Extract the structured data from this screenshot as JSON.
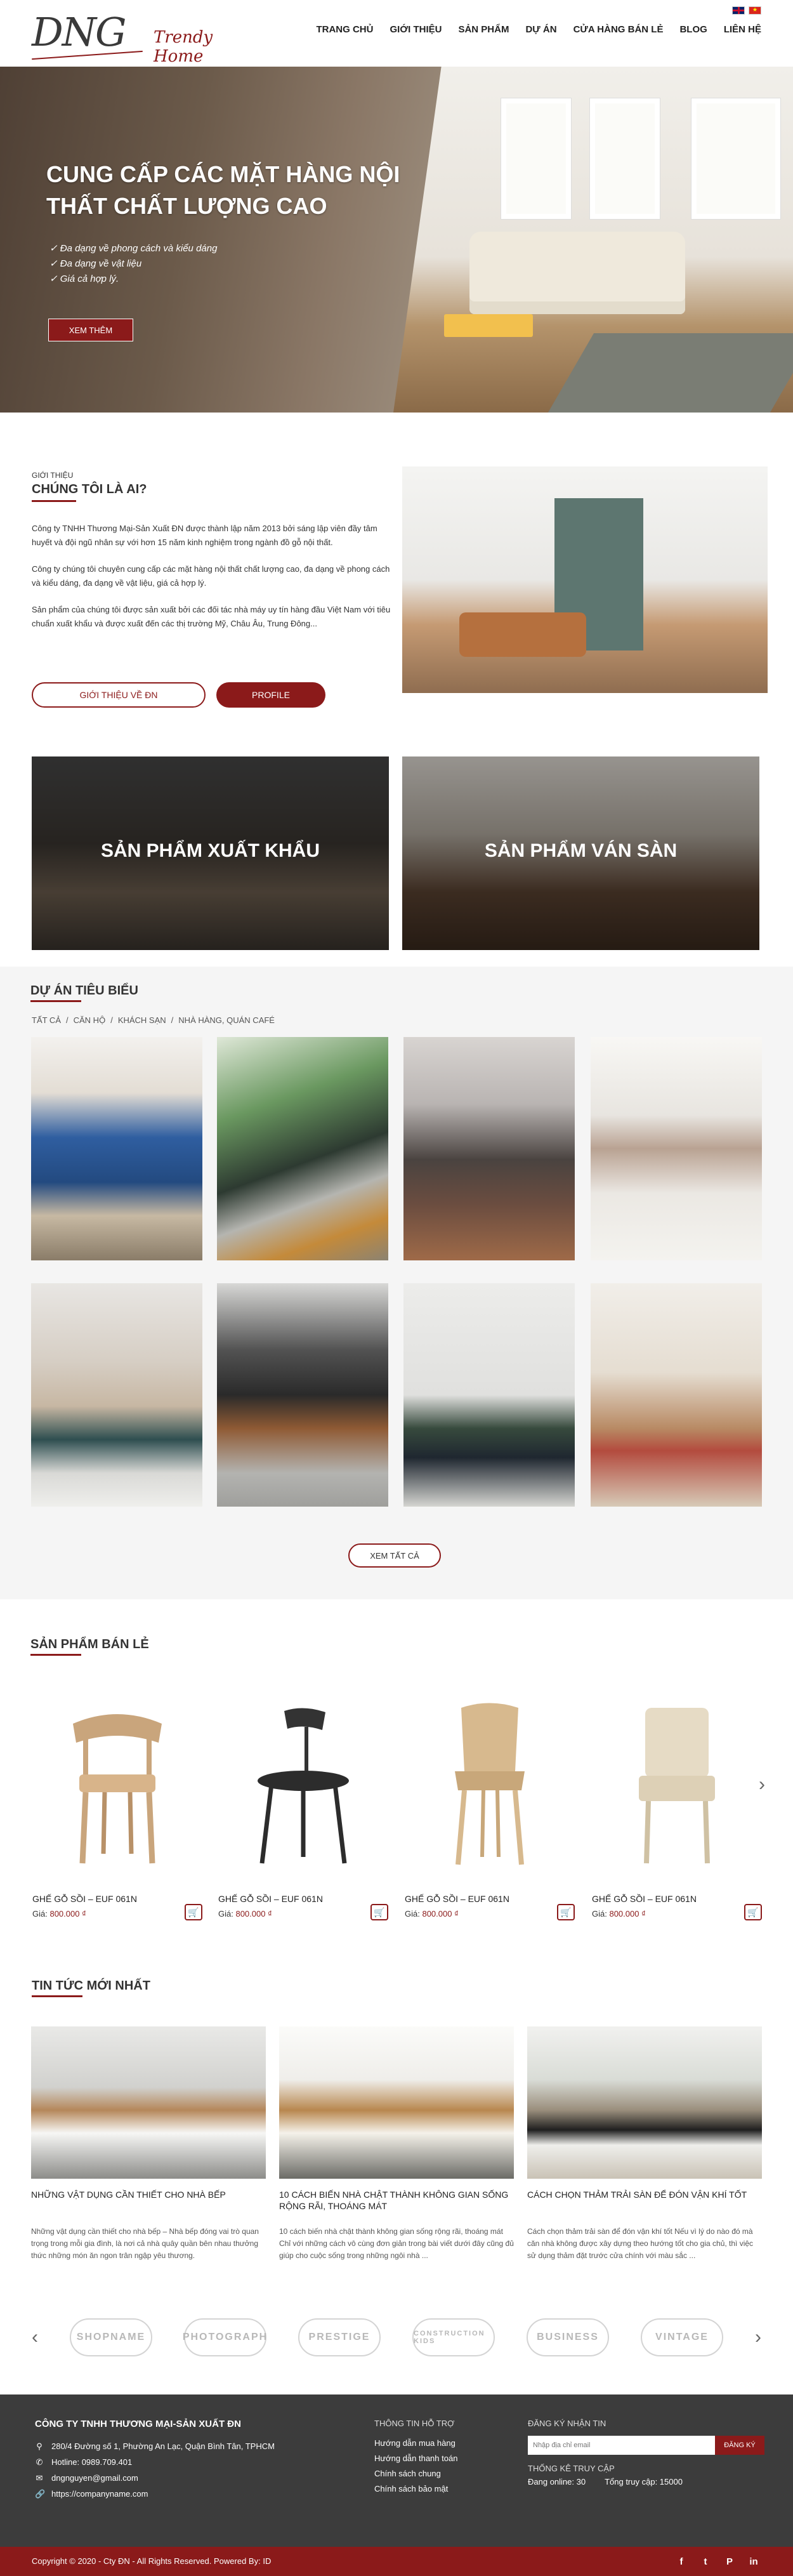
{
  "brand": {
    "logo_text": "DNG",
    "tagline": "Trendy Home"
  },
  "nav": [
    "TRANG CHỦ",
    "GIỚI THIỆU",
    "SẢN PHẨM",
    "DỰ ÁN",
    "CỬA HÀNG BÁN LẺ",
    "BLOG",
    "LIÊN HỆ"
  ],
  "hero": {
    "title": "CUNG CẤP CÁC MẶT HÀNG NỘI THẤT CHẤT LƯỢNG CAO",
    "features": [
      "Đa dạng về phong cách và kiểu dáng",
      "Đa dạng về vật liệu",
      "Giá cả hợp lý."
    ],
    "button": "XEM THÊM"
  },
  "about": {
    "small_label": "GIỚI THIỆU",
    "title": "CHÚNG TÔI LÀ AI?",
    "paragraphs": [
      "Công ty TNHH Thương Mại-Sản Xuất ĐN được thành lập năm 2013 bởi sáng lập viên đầy tâm huyết và đội ngũ nhân sự với hơn 15 năm kinh nghiệm trong ngành đồ gỗ nội thất.",
      "Công ty chúng tôi chuyên cung cấp các mặt hàng nội thất chất lượng cao, đa dạng về phong cách và kiểu dáng, đa dạng về vật liệu, giá cả hợp lý.",
      "Sản phẩm của chúng tôi được sản xuất bởi các đối tác nhà máy uy tín hàng đầu Việt Nam với tiêu chuẩn xuất khẩu và được xuất đến các thị trường Mỹ, Châu Âu, Trung Đông..."
    ],
    "btn_about": "GIỚI THIỆU VỀ ĐN",
    "btn_profile": "PROFILE"
  },
  "categories": [
    "SẢN PHẨM XUẤT KHẨU",
    "SẢN PHẨM VÁN SÀN"
  ],
  "projects": {
    "title": "DỰ ÁN TIÊU BIỂU",
    "filters": [
      "TẤT CẢ",
      "CĂN HỘ",
      "KHÁCH SẠN",
      "NHÀ HÀNG, QUÁN CAFÉ"
    ],
    "separator": "/",
    "view_all": "XEM TẤT CẢ"
  },
  "products": {
    "title": "SẢN PHẨM BÁN LẺ",
    "price_label": "Giá:",
    "items": [
      {
        "name": "GHẾ GỖ SỒI – EUF 061N",
        "price": "800.000 ₫"
      },
      {
        "name": "GHẾ GỖ SỒI – EUF 061N",
        "price": "800.000 ₫"
      },
      {
        "name": "GHẾ GỖ SỒI – EUF 061N",
        "price": "800.000 ₫"
      },
      {
        "name": "GHẾ GỖ SỒI – EUF 061N",
        "price": "800.000 ₫"
      }
    ]
  },
  "news": {
    "title": "TIN TỨC MỚI NHẤT",
    "items": [
      {
        "title": "NHỮNG VẬT DỤNG CẦN THIẾT CHO NHÀ BẾP",
        "excerpt": "Những vật dụng cần thiết cho nhà bếp – Nhà bếp đóng vai trò quan trọng trong mỗi gia đình, là nơi cả nhà quây quần bên nhau thưởng thức những món ăn ngon trân ngập yêu thương."
      },
      {
        "title": "10 CÁCH BIẾN NHÀ CHẬT THÀNH KHÔNG GIAN SỐNG RỘNG RÃI, THOÁNG MÁT",
        "excerpt": "10 cách biến nhà chật thành không gian sống rộng rãi, thoáng mát Chỉ với những cách vô cùng đơn giản trong bài viết dưới đây cũng đủ giúp cho cuộc sống trong những ngôi nhà ..."
      },
      {
        "title": "CÁCH CHỌN THẢM TRẢI SÀN ĐỂ ĐÓN VẬN KHÍ TỐT",
        "excerpt": "Cách chọn thảm trải sàn để đón vận khí tốt Nếu vì lý do nào đó mà căn nhà không được xây dựng theo hướng tốt cho gia chủ, thì việc sử dụng thảm đặt trước cửa chính với màu sắc ..."
      }
    ]
  },
  "partners": [
    "SHOPNAME",
    "PHOTOGRAPH",
    "PRESTIGE",
    "CONSTRUCTION KIDS",
    "BUSINESS",
    "VINTAGE"
  ],
  "footer": {
    "company": "CÔNG TY TNHH THƯƠNG MẠI-SẢN XUẤT ĐN",
    "address": "280/4 Đường số 1, Phường An Lạc, Quận Bình Tân, TPHCM",
    "hotline": "Hotline: 0989.709.401",
    "email": "dngnguyen@gmail.com",
    "website": "https://companyname.com",
    "support_title": "THÔNG TIN HỖ TRỢ",
    "support_links": [
      "Hướng dẫn mua hàng",
      "Hướng dẫn thanh toán",
      "Chính sách chung",
      "Chính sách bảo mật"
    ],
    "newsletter_title": "ĐĂNG KÝ NHẬN TIN",
    "newsletter_placeholder": "Nhập địa chỉ email",
    "newsletter_button": "ĐĂNG KÝ",
    "stats_title": "THỐNG KÊ TRUY CẬP",
    "online": "Đang online: 30",
    "total": "Tổng truy cập: 15000"
  },
  "copyright": "Copyright © 2020 - Cty ĐN - All Rights Reserved. Powered By: ID",
  "colors": {
    "brand": "#8b1a1a",
    "footer": "#3c3c3c"
  }
}
